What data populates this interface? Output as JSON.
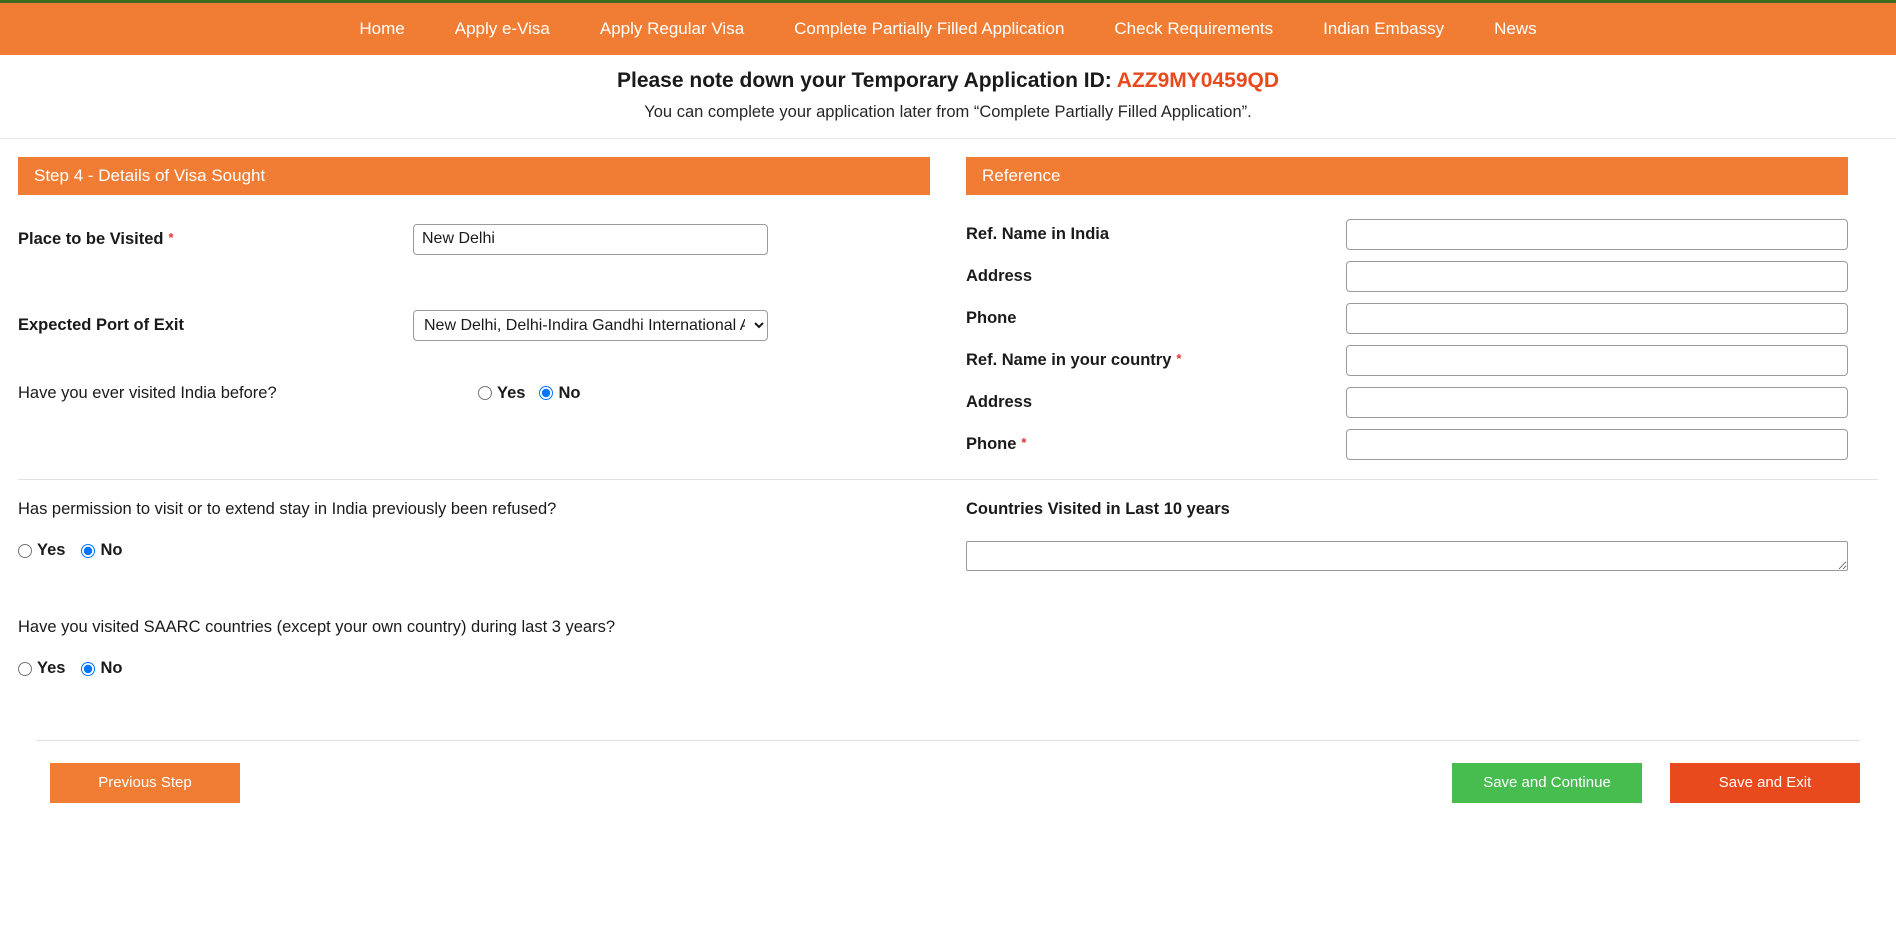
{
  "nav": {
    "items": [
      {
        "label": "Home",
        "name": "nav-home"
      },
      {
        "label": "Apply e-Visa",
        "name": "nav-apply-evisa"
      },
      {
        "label": "Apply Regular Visa",
        "name": "nav-apply-regular-visa"
      },
      {
        "label": "Complete Partially Filled Application",
        "name": "nav-complete-partially-filled-application"
      },
      {
        "label": "Check Requirements",
        "name": "nav-check-requirements"
      },
      {
        "label": "Indian Embassy",
        "name": "nav-indian-embassy"
      },
      {
        "label": "News",
        "name": "nav-news"
      }
    ]
  },
  "notice": {
    "title_prefix": "Please note down your Temporary Application ID: ",
    "application_id": "AZZ9MY0459QD",
    "subtitle": "You can complete your application later from “Complete Partially Filled Application”."
  },
  "left_panel": {
    "header": "Step 4 - Details of Visa Sought",
    "place_to_be_visited": {
      "label": "Place to be Visited",
      "required_marker": "*",
      "value": "New Delhi",
      "placeholder": ""
    },
    "expected_port_of_exit": {
      "label": "Expected Port of Exit",
      "selected": "New Delhi, Delhi-Indira Gandhi International Airport",
      "options": [
        "New Delhi, Delhi-Indira Gandhi International Airport"
      ]
    },
    "visited_india_before": {
      "label": "Have you ever visited India before?",
      "options": [
        "Yes",
        "No"
      ],
      "selected": "No"
    }
  },
  "right_panel": {
    "header": "Reference",
    "fields": [
      {
        "label": "Ref. Name in India",
        "required_marker": "",
        "value": "",
        "name": "ref-name-in-india"
      },
      {
        "label": "Address",
        "required_marker": "",
        "value": "",
        "name": "ref-india-address"
      },
      {
        "label": "Phone",
        "required_marker": "",
        "value": "",
        "name": "ref-india-phone"
      },
      {
        "label": "Ref. Name in your country",
        "required_marker": "*",
        "value": "",
        "name": "ref-name-in-your-country"
      },
      {
        "label": "Address",
        "required_marker": "",
        "value": "",
        "name": "ref-country-address"
      },
      {
        "label": "Phone",
        "required_marker": "*",
        "value": "",
        "name": "ref-country-phone"
      }
    ]
  },
  "lower": {
    "permission_refused": {
      "label": "Has permission to visit or to extend stay in India previously been refused?",
      "options": [
        "Yes",
        "No"
      ],
      "selected": "No"
    },
    "saarc_visited": {
      "label": "Have you visited SAARC countries (except your own country) during last 3 years?",
      "options": [
        "Yes",
        "No"
      ],
      "selected": "No"
    },
    "countries_visited": {
      "label": "Countries Visited in Last 10 years",
      "value": "",
      "placeholder": ""
    }
  },
  "footer": {
    "previous_step": "Previous Step",
    "save_and_continue": "Save and Continue",
    "save_and_exit": "Save and Exit"
  },
  "colors": {
    "brand_orange": "#f07d33",
    "accent_red": "#e8491d",
    "green": "#46bd4e",
    "required_red": "#e8312f",
    "topbar_green": "#3f6b1e"
  }
}
